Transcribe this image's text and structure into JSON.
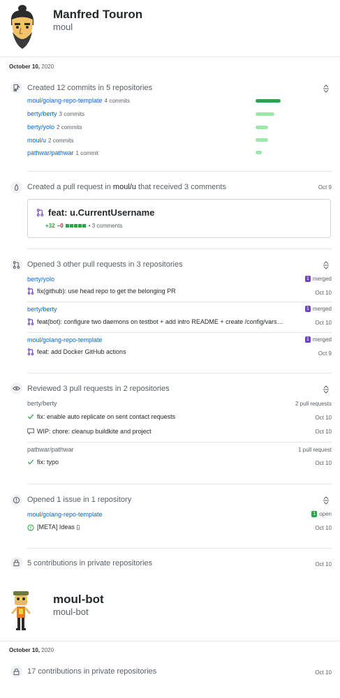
{
  "profiles": [
    {
      "name": "Manfred Touron",
      "login": "moul",
      "date": "October 10,",
      "year": "2020",
      "commits": {
        "title": "Created 12 commits in 5 repositories",
        "repos": [
          {
            "name": "moul/golang-repo-template",
            "count": "4 commits",
            "share": 1.0
          },
          {
            "name": "berty/berty",
            "count": "3 commits",
            "share": 0.75
          },
          {
            "name": "berty/yolo",
            "count": "2 commits",
            "share": 0.5
          },
          {
            "name": "moul/u",
            "count": "2 commits",
            "share": 0.5
          },
          {
            "name": "pathwar/pathwar",
            "count": "1 commit",
            "share": 0.25
          }
        ]
      },
      "created_pr": {
        "title_prefix": "Created a pull request in",
        "repo": "moul/u",
        "title_suffix": "that received 3 comments",
        "date": "Oct 9",
        "pr_title": "feat: u.CurrentUsername",
        "additions": "+32",
        "deletions": "−0",
        "comments": "• 3 comments"
      },
      "opened_prs": {
        "title": "Opened 3 other pull requests in 3 repositories",
        "items": [
          {
            "repo": "berty/yolo",
            "badge": "1",
            "status": "merged",
            "title": "fix(github): use head repo to get the belonging PR",
            "date": "Oct 10"
          },
          {
            "repo": "berty/berty",
            "badge": "1",
            "status": "merged",
            "title": "feat(bot): configure two daemons on testbot + add intro README + create /config/vars…",
            "date": "Oct 10"
          },
          {
            "repo": "moul/golang-repo-template",
            "badge": "1",
            "status": "merged",
            "title": "feat: add Docker GitHub actions",
            "date": "Oct 9"
          }
        ]
      },
      "reviewed": {
        "title": "Reviewed 3 pull requests in 2 repositories",
        "groups": [
          {
            "repo": "berty/berty",
            "count": "2 pull requests",
            "items": [
              {
                "title": "fix: enable auto replicate on sent contact requests",
                "date": "Oct 10",
                "icon": "check-icon"
              },
              {
                "title": "WIP: chore: cleanup buildkite and project",
                "date": "Oct 10",
                "icon": "comment-icon"
              }
            ]
          },
          {
            "repo": "pathwar/pathwar",
            "count": "1 pull request",
            "items": [
              {
                "title": "fix: typo",
                "date": "Oct 10",
                "icon": "check-icon"
              }
            ]
          }
        ]
      },
      "issues": {
        "title": "Opened 1 issue in 1 repository",
        "repo": "moul/golang-repo-template",
        "badge": "1",
        "status": "open",
        "item": "[META] Ideas ▯",
        "date": "Oct 10"
      },
      "private": {
        "title": "5 contributions in private repositories",
        "date": "Oct 10"
      }
    },
    {
      "name": "moul-bot",
      "login": "moul-bot",
      "date": "October 10,",
      "year": "2020",
      "private": {
        "title": "17 contributions in private repositories",
        "date": "Oct 10"
      }
    }
  ],
  "colors": {
    "link": "#0366d6",
    "bar_strong": "#2ea44f",
    "bar_light": "#9be9a8",
    "merged": "#6f42c1",
    "open": "#28a745"
  }
}
